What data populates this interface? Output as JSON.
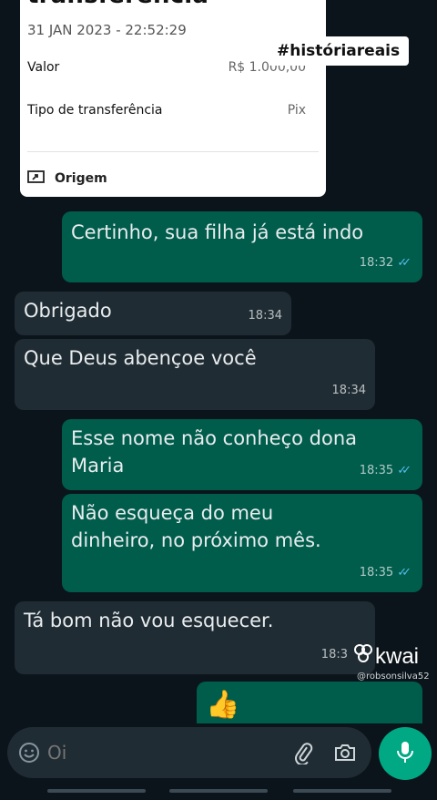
{
  "receipt": {
    "title": "transferência",
    "date": "31 JAN 2023 - 22:52:29",
    "rows": [
      {
        "label": "Valor",
        "value": "R$ 1.000,00"
      },
      {
        "label": "Tipo de transferência",
        "value": "Pix"
      }
    ],
    "origin_label": "Origem"
  },
  "overlay": {
    "hashtag": "#históriareais",
    "watermark_brand": "kwai",
    "watermark_user": "@robsonsilva52"
  },
  "messages": [
    {
      "dir": "out",
      "text": "Certinho, sua filha já está indo",
      "time": "18:32"
    },
    {
      "dir": "in",
      "text": "Obrigado",
      "time": "18:34"
    },
    {
      "dir": "in",
      "text": "Que Deus abençoe você",
      "time": "18:34"
    },
    {
      "dir": "out",
      "text": "Esse nome não conheço dona Maria",
      "time": "18:35"
    },
    {
      "dir": "out",
      "text": "Não esqueça do meu dinheiro, no próximo mês.",
      "time": "18:35"
    },
    {
      "dir": "in",
      "text": "Tá bom não vou esquecer.",
      "time": "18:3"
    },
    {
      "dir": "out",
      "text": "👍",
      "time": ""
    }
  ],
  "composer": {
    "placeholder": "Oi",
    "icons": [
      "emoji-icon",
      "attach-icon",
      "camera-icon",
      "mic-icon"
    ]
  },
  "colors": {
    "background": "#0b141a",
    "outgoing": "#005c4b",
    "incoming": "#202c33",
    "accent": "#00a884",
    "read_ticks": "#53bdeb"
  }
}
